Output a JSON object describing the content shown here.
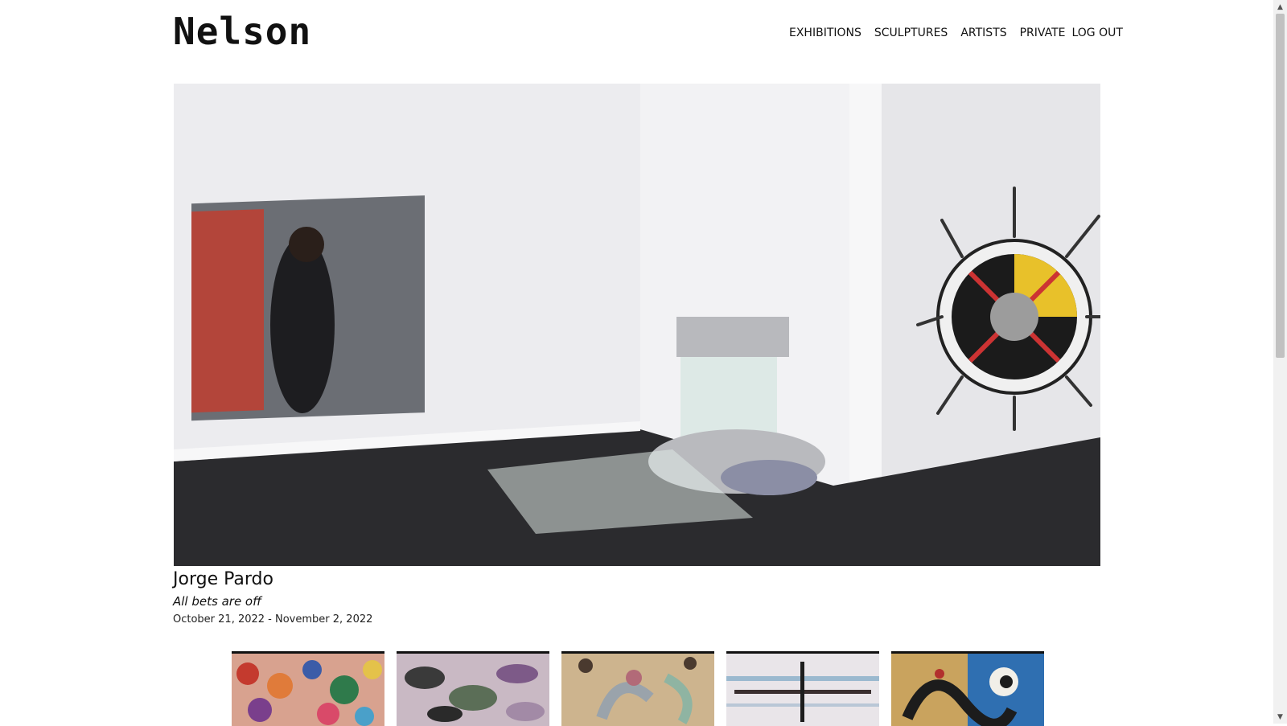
{
  "site": {
    "logo": "Nelson"
  },
  "nav": {
    "items": [
      {
        "label": "EXHIBITIONS"
      },
      {
        "label": "SCULPTURES"
      },
      {
        "label": "ARTISTS"
      },
      {
        "label": "PRIVATE"
      },
      {
        "label": "LOG OUT"
      }
    ]
  },
  "hero": {
    "artist": "Jorge Pardo",
    "title": "All bets are off",
    "dates": "October 21, 2022 - November 2, 2022"
  },
  "thumbnails": [
    {
      "icon": "floral-painting-thumb"
    },
    {
      "icon": "paisley-painting-thumb"
    },
    {
      "icon": "abstract-shapes-thumb"
    },
    {
      "icon": "horizontal-lines-thumb"
    },
    {
      "icon": "expressive-figure-thumb"
    }
  ],
  "colors": {
    "text": "#111111",
    "background": "#ffffff",
    "gallery_wall": "#e9e9ec",
    "gallery_floor": "#2b2b2e"
  }
}
